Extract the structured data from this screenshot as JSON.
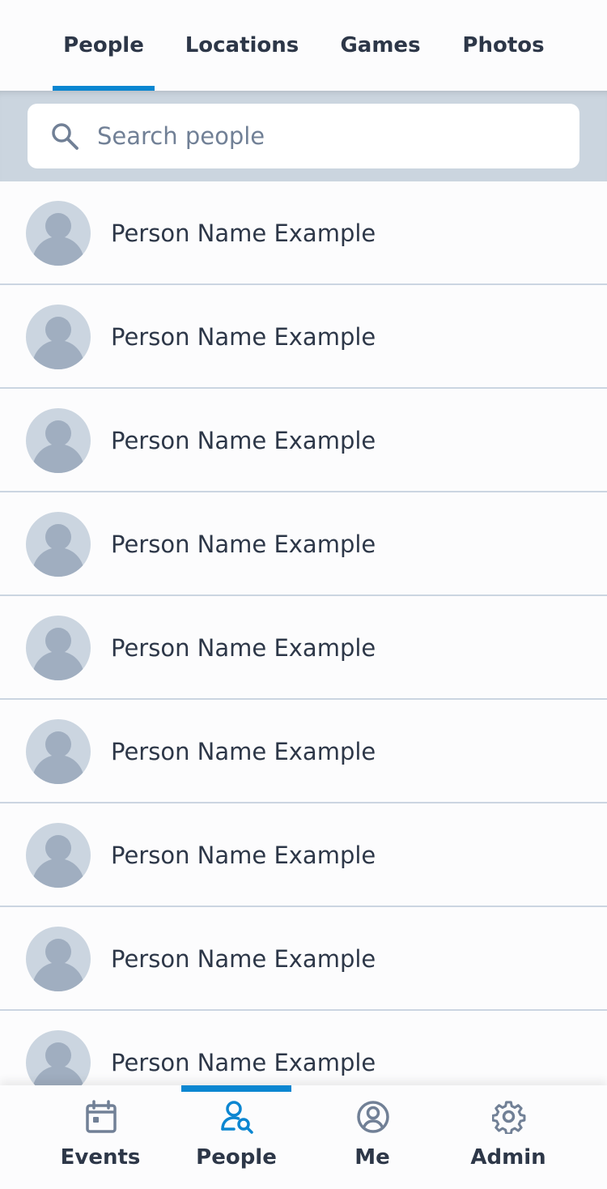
{
  "top_tabs": [
    {
      "label": "People",
      "active": true
    },
    {
      "label": "Locations",
      "active": false
    },
    {
      "label": "Games",
      "active": false
    },
    {
      "label": "Photos",
      "active": false
    }
  ],
  "search": {
    "placeholder": "Search people",
    "value": "",
    "icon": "search-icon"
  },
  "people": [
    {
      "name": "Person Name Example",
      "avatar": "default-avatar-icon"
    },
    {
      "name": "Person Name Example",
      "avatar": "default-avatar-icon"
    },
    {
      "name": "Person Name Example",
      "avatar": "default-avatar-icon"
    },
    {
      "name": "Person Name Example",
      "avatar": "default-avatar-icon"
    },
    {
      "name": "Person Name Example",
      "avatar": "default-avatar-icon"
    },
    {
      "name": "Person Name Example",
      "avatar": "default-avatar-icon"
    },
    {
      "name": "Person Name Example",
      "avatar": "default-avatar-icon"
    },
    {
      "name": "Person Name Example",
      "avatar": "default-avatar-icon"
    },
    {
      "name": "Person Name Example",
      "avatar": "default-avatar-icon"
    }
  ],
  "bottom_nav": [
    {
      "label": "Events",
      "icon": "calendar-icon",
      "active": false
    },
    {
      "label": "People",
      "icon": "people-search-icon",
      "active": true
    },
    {
      "label": "Me",
      "icon": "user-circle-icon",
      "active": false
    },
    {
      "label": "Admin",
      "icon": "gear-icon",
      "active": false
    }
  ],
  "colors": {
    "accent": "#0b86d1",
    "text": "#2d3748",
    "search_band": "#cbd5df",
    "avatar_bg": "#cbd5e0",
    "avatar_fg": "#a0aec0",
    "icon_inactive": "#718096"
  }
}
